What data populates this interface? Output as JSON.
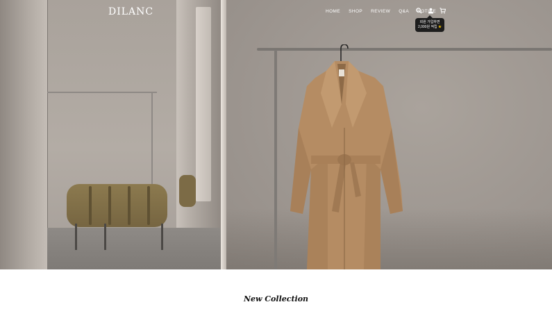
{
  "header": {
    "logo": "DILANC",
    "nav": [
      {
        "label": "HOME"
      },
      {
        "label": "SHOP"
      },
      {
        "label": "REVIEW"
      },
      {
        "label": "Q&A"
      },
      {
        "label": "NOTICE"
      }
    ],
    "icons": [
      "search-icon",
      "user-icon",
      "cart-icon"
    ],
    "signup_tooltip": {
      "line1": "회원 가입하면",
      "line2": "2,000원 적립",
      "badge": "★"
    }
  },
  "hero": {
    "image": "coat-on-rack-showroom"
  },
  "section": {
    "title": "New Collection"
  },
  "colors": {
    "nav_text": "#ffffff",
    "tooltip_bg": "#1d1d1d",
    "coat": "#b89168"
  }
}
